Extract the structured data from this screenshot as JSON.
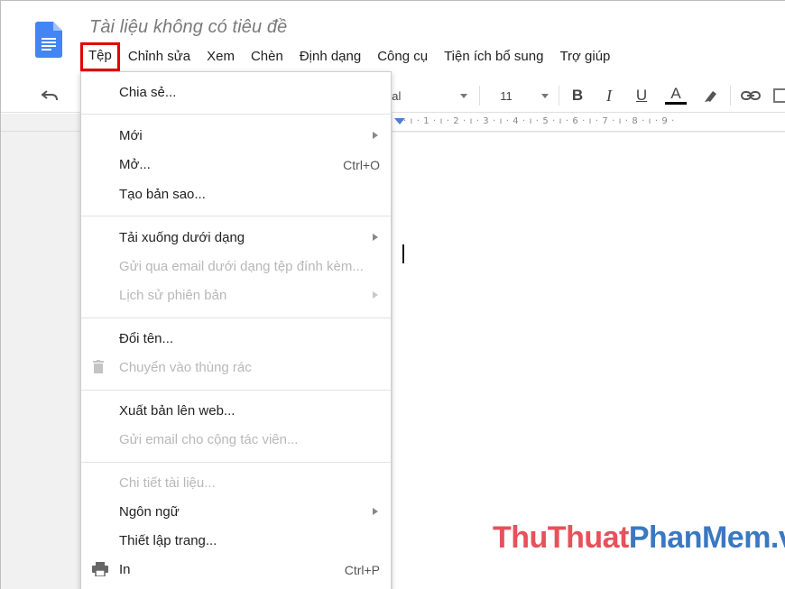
{
  "document": {
    "title": "Tài liệu không có tiêu đề"
  },
  "menubar": {
    "items": [
      {
        "label": "Tệp"
      },
      {
        "label": "Chỉnh sửa"
      },
      {
        "label": "Xem"
      },
      {
        "label": "Chèn"
      },
      {
        "label": "Định dạng"
      },
      {
        "label": "Công cụ"
      },
      {
        "label": "Tiện ích bổ sung"
      },
      {
        "label": "Trợ giúp"
      }
    ],
    "active_item": "Tệp",
    "highlight_color": "#e00000"
  },
  "toolbar": {
    "font_name": "rial",
    "font_size": "11",
    "bold_label": "B",
    "italic_label": "I",
    "underline_label": "U",
    "text_color_label": "A"
  },
  "ruler": {
    "text": "· ı · 1 · ı · 2 · ı · 3 · ı · 4 · ı · 5 · ı · 6 · ı · 7 · ı · 8 · ı · 9 ·"
  },
  "file_menu": {
    "share": "Chia sẻ...",
    "new": "Mới",
    "open": "Mở...",
    "open_shortcut": "Ctrl+O",
    "make_copy": "Tạo bản sao...",
    "download_as": "Tải xuống dưới dạng",
    "email_attachment": "Gửi qua email dưới dạng tệp đính kèm...",
    "version_history": "Lịch sử phiên bản",
    "rename": "Đổi tên...",
    "move_to_trash": "Chuyển vào thùng rác",
    "publish_to_web": "Xuất bản lên web...",
    "email_collaborators": "Gửi email cho cộng tác viên...",
    "document_details": "Chi tiết tài liệu...",
    "language": "Ngôn ngữ",
    "page_setup": "Thiết lập trang...",
    "print": "In",
    "print_shortcut": "Ctrl+P"
  },
  "watermark": {
    "part1": "ThuThuat",
    "part2": "PhanMem.vn",
    "color1": "#e8505b",
    "color2": "#3b78c2"
  }
}
